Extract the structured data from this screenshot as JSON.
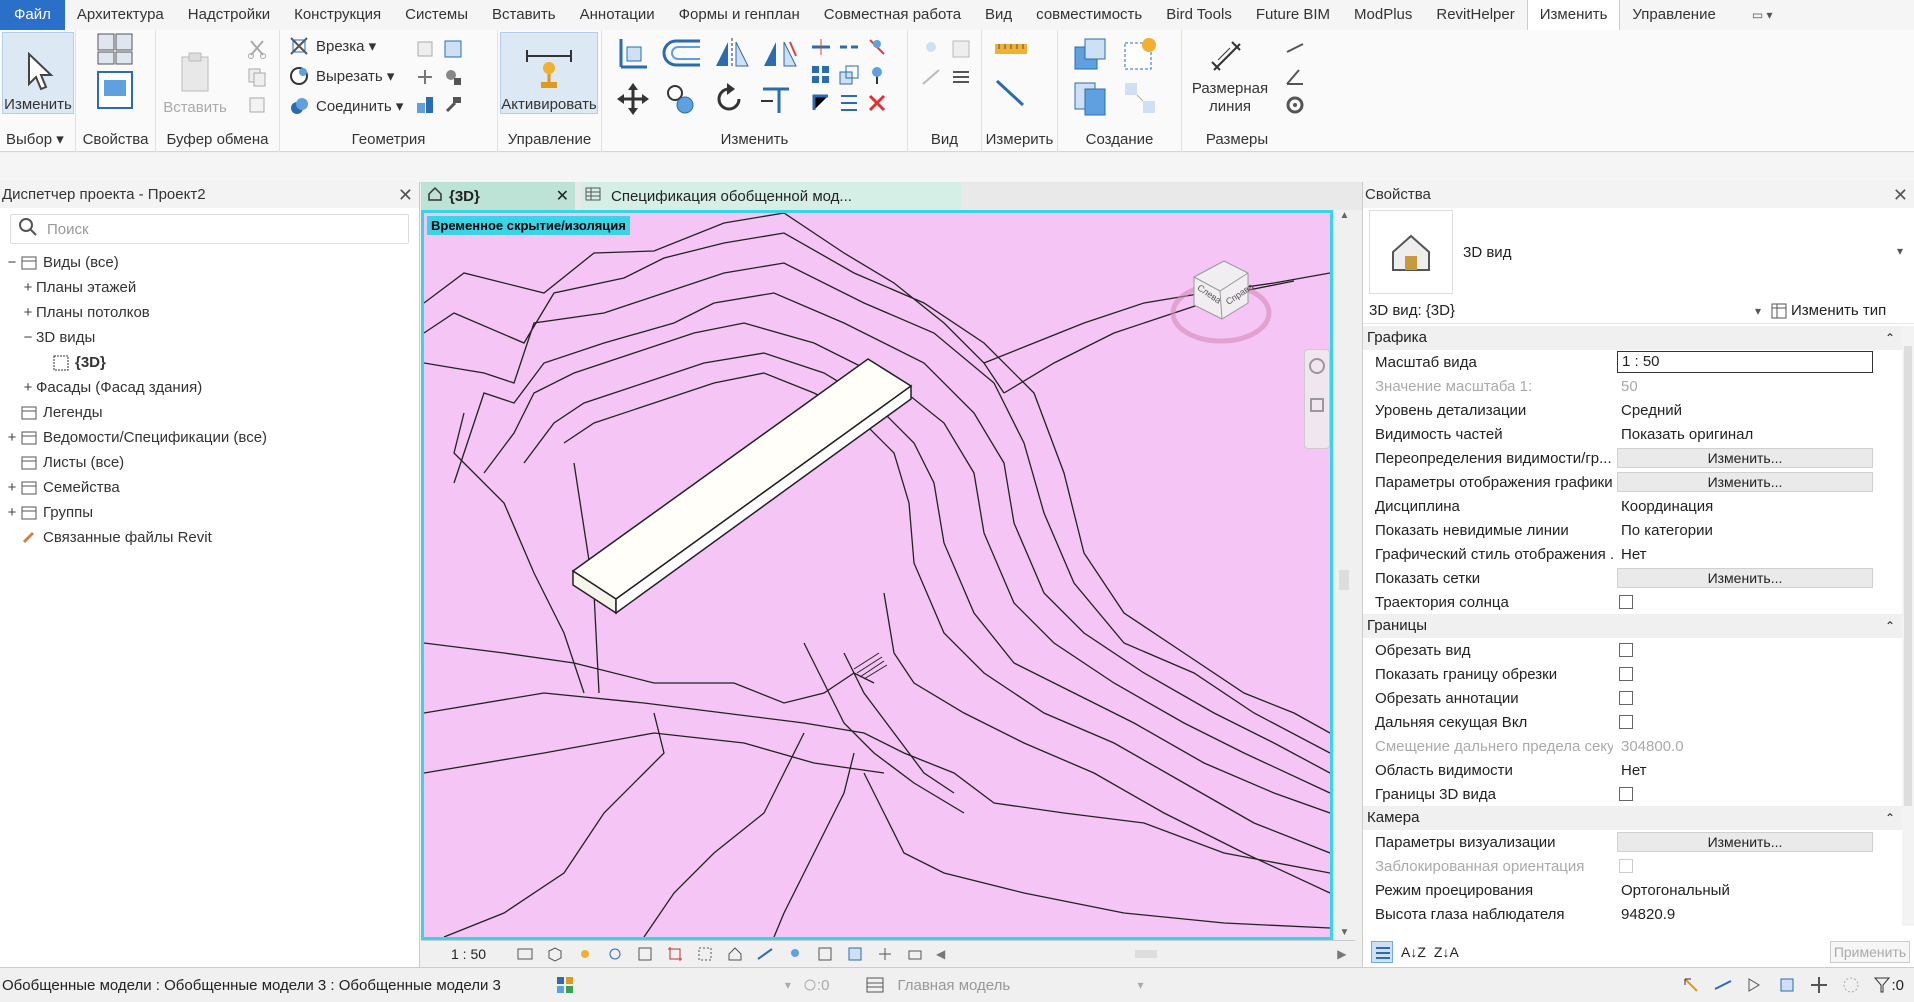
{
  "menu": {
    "tabs": [
      "Файл",
      "Архитектура",
      "Надстройки",
      "Конструкция",
      "Системы",
      "Вставить",
      "Аннотации",
      "Формы и генплан",
      "Совместная работа",
      "Вид",
      "совместимость",
      "Bird Tools",
      "Future BIM",
      "ModPlus",
      "RevitHelper",
      "Изменить",
      "Управление"
    ],
    "active": "Изменить"
  },
  "ribbon": {
    "modify_label": "Изменить",
    "select_label": "Выбор",
    "properties_label": "Свойства",
    "paste_label": "Вставить",
    "clipboard_label": "Буфер обмена",
    "cut_join": [
      "Врезка",
      "Вырезать",
      "Соединить"
    ],
    "geometry_label": "Геометрия",
    "activate_label": "Активировать",
    "control_label": "Управление",
    "modify_group_label": "Изменить",
    "view_label": "Вид",
    "measure_label": "Измерить",
    "create_label": "Создание",
    "dimension_button": "Размерная линия",
    "dimensions_label": "Размеры"
  },
  "browser": {
    "title": "Диспетчер проекта - Проект2",
    "search_placeholder": "Поиск",
    "nodes": [
      {
        "label": "Виды (все)",
        "level": 0,
        "exp": "−"
      },
      {
        "label": "Планы этажей",
        "level": 1,
        "exp": "+"
      },
      {
        "label": "Планы потолков",
        "level": 1,
        "exp": "+"
      },
      {
        "label": "3D виды",
        "level": 1,
        "exp": "−"
      },
      {
        "label": "{3D}",
        "level": 2,
        "exp": ""
      },
      {
        "label": "Фасады (Фасад здания)",
        "level": 1,
        "exp": "+"
      },
      {
        "label": "Легенды",
        "level": 0,
        "exp": ""
      },
      {
        "label": "Ведомости/Спецификации (все)",
        "level": 0,
        "exp": "+"
      },
      {
        "label": "Листы (все)",
        "level": 0,
        "exp": ""
      },
      {
        "label": "Семейства",
        "level": 0,
        "exp": "+"
      },
      {
        "label": "Группы",
        "level": 0,
        "exp": "+"
      },
      {
        "label": "Связанные файлы Revit",
        "level": 0,
        "exp": ""
      }
    ]
  },
  "tabs": {
    "tab1": "{3D}",
    "tab2": "Спецификация обобщенной мод..."
  },
  "viewport": {
    "iso_label": "Временное скрытие/изоляция",
    "scale": "1 : 50",
    "viewcube": {
      "front": "Справа",
      "side": "Слева"
    }
  },
  "props": {
    "title": "Свойства",
    "type_name": "3D вид",
    "instance": "3D вид: {3D}",
    "edit_type": "Изменить тип",
    "sections": [
      {
        "title": "Графика",
        "rows": [
          {
            "name": "Масштаб вида",
            "value": "1 : 50",
            "kind": "input"
          },
          {
            "name": "Значение масштаба    1:",
            "value": "50",
            "kind": "dim"
          },
          {
            "name": "Уровень детализации",
            "value": "Средний",
            "kind": "text"
          },
          {
            "name": "Видимость частей",
            "value": "Показать оригинал",
            "kind": "text"
          },
          {
            "name": "Переопределения видимости/гр...",
            "value": "Изменить...",
            "kind": "button"
          },
          {
            "name": "Параметры отображения графики",
            "value": "Изменить...",
            "kind": "button"
          },
          {
            "name": "Дисциплина",
            "value": "Координация",
            "kind": "text"
          },
          {
            "name": "Показать невидимые линии",
            "value": "По категории",
            "kind": "text"
          },
          {
            "name": "Графический стиль отображения ...",
            "value": "Нет",
            "kind": "text"
          },
          {
            "name": "Показать сетки",
            "value": "Изменить...",
            "kind": "button"
          },
          {
            "name": "Траектория солнца",
            "value": "",
            "kind": "check"
          }
        ]
      },
      {
        "title": "Границы",
        "rows": [
          {
            "name": "Обрезать вид",
            "value": "",
            "kind": "check"
          },
          {
            "name": "Показать границу обрезки",
            "value": "",
            "kind": "check"
          },
          {
            "name": "Обрезать аннотации",
            "value": "",
            "kind": "check"
          },
          {
            "name": "Дальняя секущая Вкл",
            "value": "",
            "kind": "check"
          },
          {
            "name": "Смещение дальнего предела секу...",
            "value": "304800.0",
            "kind": "dim"
          },
          {
            "name": "Область видимости",
            "value": "Нет",
            "kind": "text"
          },
          {
            "name": "Границы 3D вида",
            "value": "",
            "kind": "check"
          }
        ]
      },
      {
        "title": "Камера",
        "rows": [
          {
            "name": "Параметры визуализации",
            "value": "Изменить...",
            "kind": "button"
          },
          {
            "name": "Заблокированная ориентация",
            "value": "",
            "kind": "dimcheck"
          },
          {
            "name": "Режим проецирования",
            "value": "Ортогональный",
            "kind": "text"
          },
          {
            "name": "Высота глаза наблюдателя",
            "value": "94820.9",
            "kind": "text"
          }
        ]
      }
    ],
    "apply": "Применить"
  },
  "status": {
    "selection": "Обобщенные модели : Обобщенные модели 3 : Обобщенные модели 3",
    "worksets": ":0",
    "model": "Главная модель",
    "filter_count": ":0"
  },
  "colors": {
    "viewport_bg": "#f5c5f5",
    "isolate_border": "#3ad4e8",
    "file_tab": "#2b70c8"
  }
}
